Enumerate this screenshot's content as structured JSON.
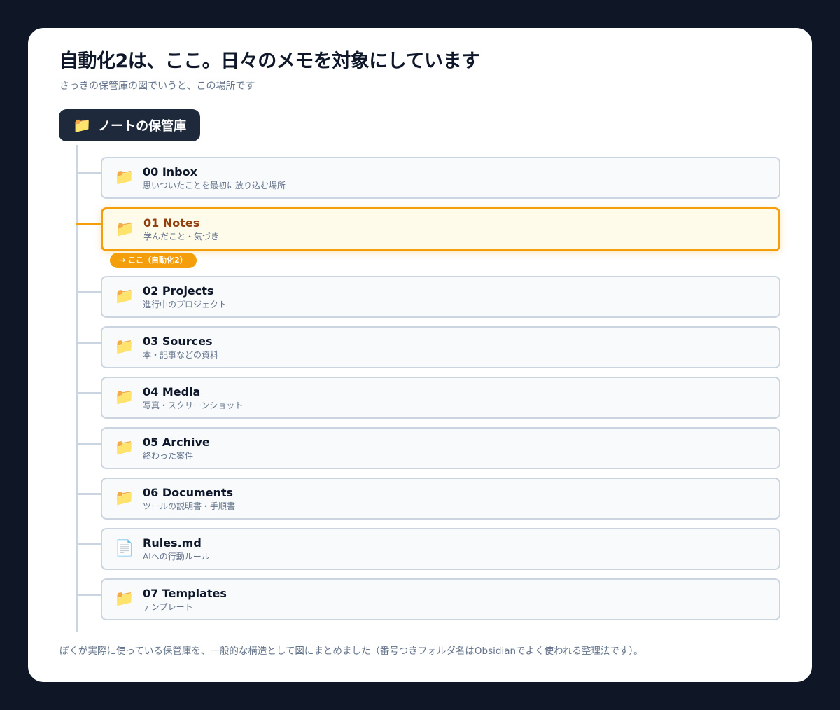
{
  "header": {
    "title": "自動化2は、ここ。日々のメモを対象にしています",
    "subtitle": "さっきの保管庫の図でいうと、この場所です"
  },
  "root": {
    "icon": "folder-icon",
    "label": "ノートの保管庫"
  },
  "badge": {
    "label": "→ ここ（自動化2）"
  },
  "items": [
    {
      "icon": "folder-icon",
      "name": "00 Inbox",
      "desc": "思いついたことを最初に放り込む場所",
      "highlight": false
    },
    {
      "icon": "folder-icon",
      "name": "01 Notes",
      "desc": "学んだこと・気づき",
      "highlight": true
    },
    {
      "icon": "folder-icon",
      "name": "02 Projects",
      "desc": "進行中のプロジェクト",
      "highlight": false
    },
    {
      "icon": "folder-icon",
      "name": "03 Sources",
      "desc": "本・記事などの資料",
      "highlight": false
    },
    {
      "icon": "folder-icon",
      "name": "04 Media",
      "desc": "写真・スクリーンショット",
      "highlight": false
    },
    {
      "icon": "folder-icon",
      "name": "05 Archive",
      "desc": "終わった案件",
      "highlight": false
    },
    {
      "icon": "folder-icon",
      "name": "06 Documents",
      "desc": "ツールの説明書・手順書",
      "highlight": false
    },
    {
      "icon": "file-icon",
      "name": "Rules.md",
      "desc": "AIへの行動ルール",
      "highlight": false
    },
    {
      "icon": "folder-icon",
      "name": "07 Templates",
      "desc": "テンプレート",
      "highlight": false
    }
  ],
  "colors": {
    "accent": "#f59e0b",
    "root_bg": "#1e293b",
    "page_bg": "#0f1626"
  },
  "footer": {
    "note": "ぼくが実際に使っている保管庫を、一般的な構造として図にまとめました（番号つきフォルダ名はObsidianでよく使われる整理法です）。"
  }
}
